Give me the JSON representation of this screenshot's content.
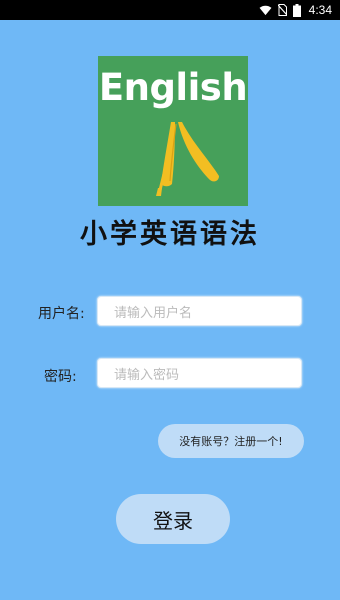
{
  "status_bar": {
    "time": "4:34",
    "icons": [
      "wifi-icon",
      "no-sim-icon",
      "battery-icon"
    ]
  },
  "logo": {
    "text": "English",
    "background_color": "#46a05a",
    "accent_color": "#f2be22"
  },
  "app_title": "小学英语语法",
  "form": {
    "username_label": "用户名:",
    "username_placeholder": "请输入用户名",
    "password_label": "密码:",
    "password_placeholder": "请输入密码"
  },
  "register_link": "没有账号？注册一个!",
  "login_button": "登录",
  "colors": {
    "background": "#6fb8f6",
    "button_bg": "#bfdcf7"
  }
}
